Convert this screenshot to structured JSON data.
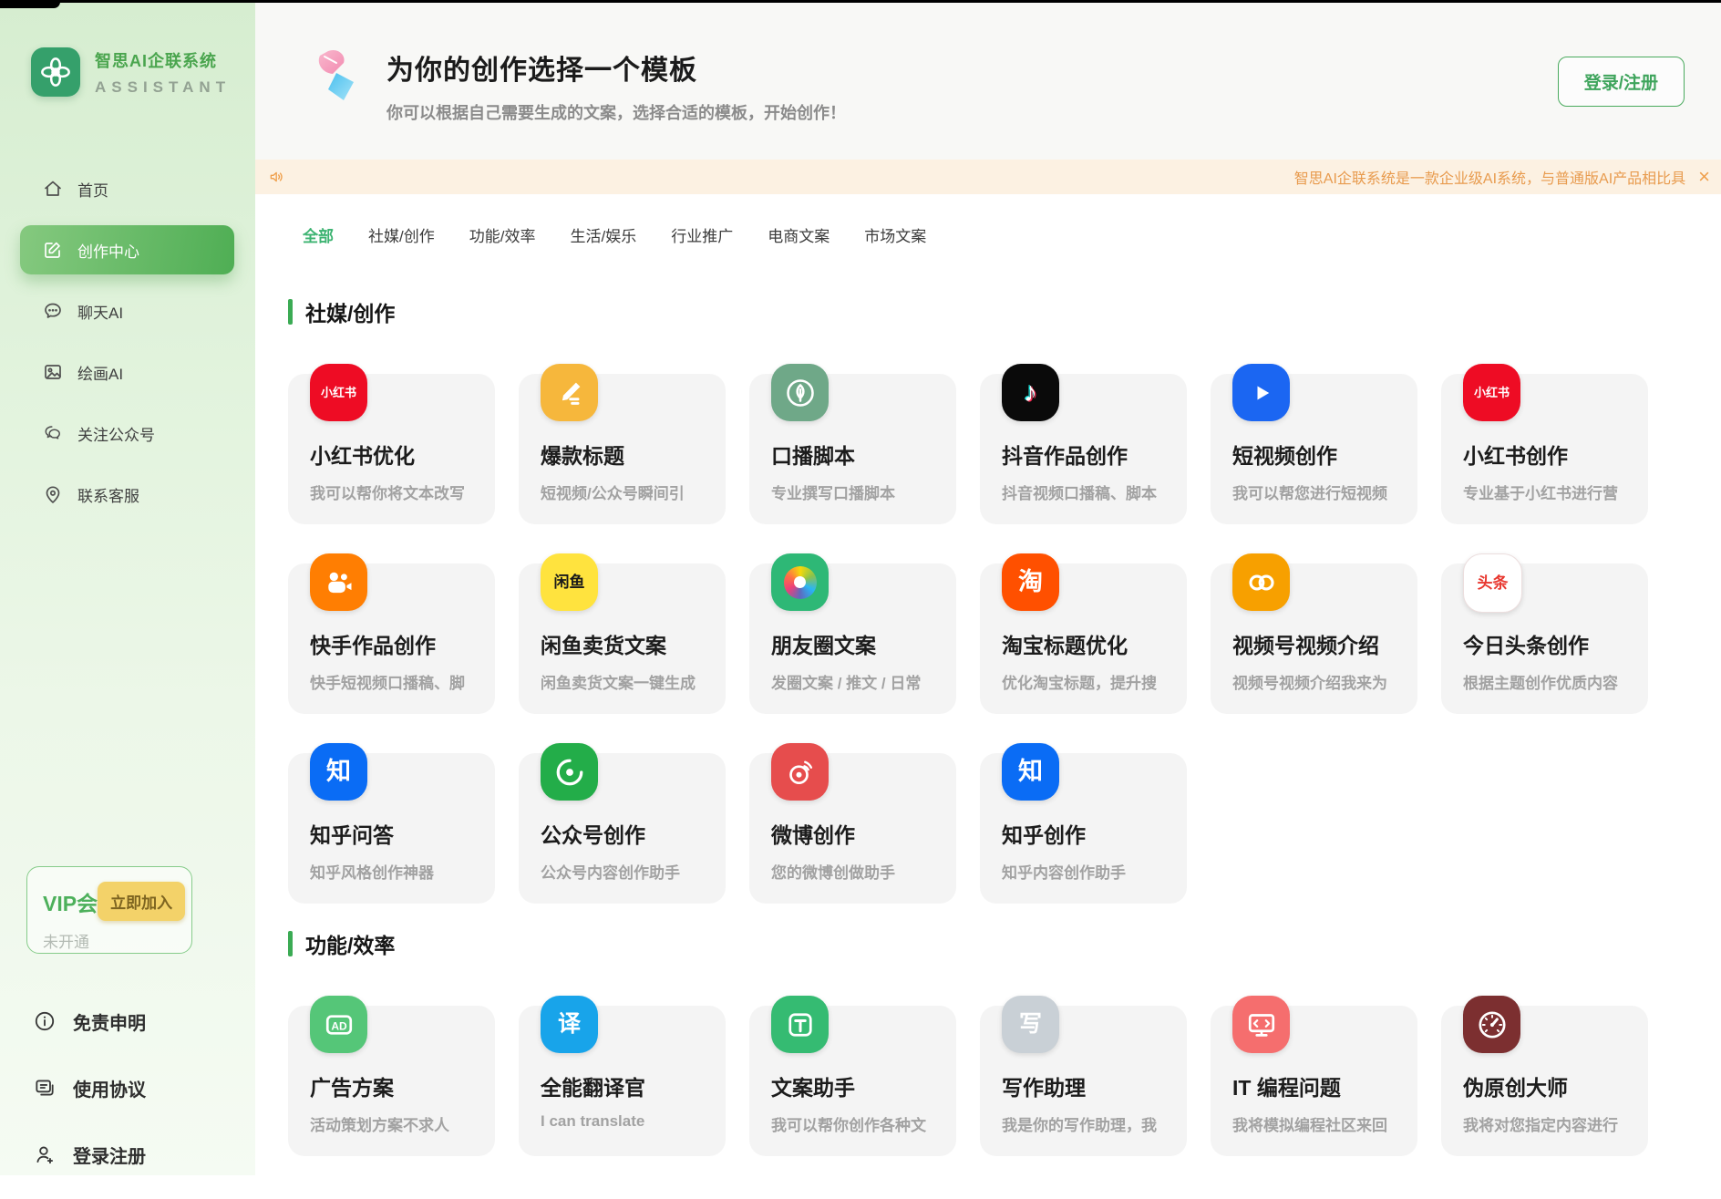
{
  "colors": {
    "accent_green": "#3cb371",
    "sidebar_active_green": "#4fae54",
    "logo_green": "#35a06b",
    "announcement_bg": "#fcf1e2",
    "announcement_text": "#e89b4e",
    "card_bg": "#f4f4f4"
  },
  "sidebar": {
    "brand": {
      "title": "智思AI企联系统",
      "subtitle": "ASSISTANT",
      "logo_icon": "knot-flower-icon"
    },
    "menu": [
      {
        "label": "首页",
        "icon": "home-icon",
        "active": false
      },
      {
        "label": "创作中心",
        "icon": "edit-icon",
        "active": true
      },
      {
        "label": "聊天AI",
        "icon": "chat-icon",
        "active": false
      },
      {
        "label": "绘画AI",
        "icon": "image-icon",
        "active": false
      },
      {
        "label": "关注公众号",
        "icon": "wechat-icon",
        "active": false
      },
      {
        "label": "联系客服",
        "icon": "location-pin-icon",
        "active": false
      }
    ],
    "vip": {
      "title": "VIP会",
      "button": "立即加入",
      "status": "未开通"
    },
    "footer": [
      {
        "label": "免责申明",
        "icon": "info-icon"
      },
      {
        "label": "使用协议",
        "icon": "agreement-icon"
      },
      {
        "label": "登录注册",
        "icon": "user-add-icon"
      }
    ]
  },
  "header": {
    "title": "为你的创作选择一个模板",
    "subtitle": "你可以根据自己需要生成的文案，选择合适的模板，开始创作！",
    "login_button": "登录/注册"
  },
  "announcement": {
    "text": "智思AI企联系统是一款企业级AI系统，与普通版AI产品相比具",
    "close": "×"
  },
  "tabs": [
    {
      "label": "全部",
      "active": true
    },
    {
      "label": "社媒/创作",
      "active": false
    },
    {
      "label": "功能/效率",
      "active": false
    },
    {
      "label": "生活/娱乐",
      "active": false
    },
    {
      "label": "行业推广",
      "active": false
    },
    {
      "label": "电商文案",
      "active": false
    },
    {
      "label": "市场文案",
      "active": false
    }
  ],
  "sections": [
    {
      "title": "社媒/创作",
      "cards": [
        {
          "title": "小红书优化",
          "desc": "我可以帮你将文本改写",
          "icon": "xiaohongshu-icon",
          "icon_bg": "#ee0c24",
          "icon_text": "小红书",
          "icon_text_size": 13,
          "icon_text_color": "#ffffff"
        },
        {
          "title": "爆款标题",
          "desc": "短视频/公众号瞬间引",
          "icon": "pencil-icon",
          "icon_bg": "#f6b73c"
        },
        {
          "title": "口播脚本",
          "desc": "专业撰写口播脚本",
          "icon": "leaf-icon",
          "icon_bg": "#6fa888"
        },
        {
          "title": "抖音作品创作",
          "desc": "抖音视频口播稿、脚本",
          "icon": "tiktok-icon",
          "icon_bg": "#0a0a0a"
        },
        {
          "title": "短视频创作",
          "desc": "我可以帮您进行短视频",
          "icon": "play-icon",
          "icon_bg": "#1b66f2"
        },
        {
          "title": "小红书创作",
          "desc": "专业基于小红书进行营",
          "icon": "xiaohongshu-icon",
          "icon_bg": "#ee0c24",
          "icon_text": "小红书",
          "icon_text_size": 13,
          "icon_text_color": "#ffffff"
        },
        {
          "title": "快手作品创作",
          "desc": "快手短视频口播稿、脚",
          "icon": "kuaishou-icon",
          "icon_bg": "#ff7e02"
        },
        {
          "title": "闲鱼卖货文案",
          "desc": "闲鱼卖货文案一键生成",
          "icon": "xianyu-icon",
          "icon_bg": "#ffe33e",
          "icon_text": "闲鱼",
          "icon_text_size": 17,
          "icon_text_color": "#1a1a1a"
        },
        {
          "title": "朋友圈文案",
          "desc": "发圈文案 / 推文 / 日常",
          "icon": "moments-aperture-icon",
          "icon_bg": "#2eb876"
        },
        {
          "title": "淘宝标题优化",
          "desc": "优化淘宝标题，提升搜",
          "icon": "taobao-icon",
          "icon_bg": "#ff5000",
          "icon_text": "淘",
          "icon_text_size": 27,
          "icon_text_color": "#ffffff"
        },
        {
          "title": "视频号视频介绍",
          "desc": "视频号视频介绍我来为",
          "icon": "channels-icon",
          "icon_bg": "#f7a000"
        },
        {
          "title": "今日头条创作",
          "desc": "根据主题创作优质内容",
          "icon": "toutiao-icon",
          "icon_bg": "#ffffff",
          "icon_border": "#ecdede",
          "icon_text": "头条",
          "icon_text_size": 17,
          "icon_text_color": "#e8372f"
        },
        {
          "title": "知乎问答",
          "desc": "知乎风格创作神器",
          "icon": "zhihu-icon",
          "icon_bg": "#0a6cf5",
          "icon_text": "知",
          "icon_text_size": 27,
          "icon_text_color": "#ffffff"
        },
        {
          "title": "公众号创作",
          "desc": "公众号内容创作助手",
          "icon": "wechat-official-icon",
          "icon_bg": "#23ad49"
        },
        {
          "title": "微博创作",
          "desc": "您的微博创做助手",
          "icon": "weibo-icon",
          "icon_bg": "#e64d4d"
        },
        {
          "title": "知乎创作",
          "desc": "知乎内容创作助手",
          "icon": "zhihu-icon",
          "icon_bg": "#0a6cf5",
          "icon_text": "知",
          "icon_text_size": 27,
          "icon_text_color": "#ffffff"
        }
      ]
    },
    {
      "title": "功能/效率",
      "cards": [
        {
          "title": "广告方案",
          "desc": "活动策划方案不求人",
          "icon": "ad-badge-icon",
          "icon_bg": "#55c678"
        },
        {
          "title": "全能翻译官",
          "desc": "I can translate",
          "icon": "translate-icon",
          "icon_bg": "#18a4ea",
          "icon_text": "译",
          "icon_text_size": 25,
          "icon_text_color": "#ffffff"
        },
        {
          "title": "文案助手",
          "desc": "我可以帮你创作各种文",
          "icon": "t-letter-icon",
          "icon_bg": "#35bb72"
        },
        {
          "title": "写作助理",
          "desc": "我是你的写作助理，我",
          "icon": "write-icon",
          "icon_bg": "#c9d0d6",
          "icon_text": "写",
          "icon_text_size": 25,
          "icon_text_color": "#ffffff"
        },
        {
          "title": "IT 编程问题",
          "desc": "我将模拟编程社区来回",
          "icon": "monitor-icon",
          "icon_bg": "#f56e6e"
        },
        {
          "title": "伪原创大师",
          "desc": "我将对您指定内容进行",
          "icon": "gauge-icon",
          "icon_bg": "#7c2f30"
        }
      ]
    }
  ]
}
